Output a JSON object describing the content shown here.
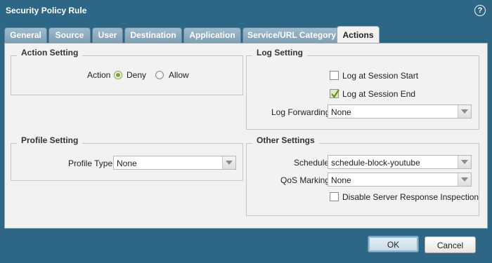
{
  "dialog": {
    "title": "Security Policy Rule"
  },
  "tabs": [
    {
      "label": "General"
    },
    {
      "label": "Source"
    },
    {
      "label": "User"
    },
    {
      "label": "Destination"
    },
    {
      "label": "Application"
    },
    {
      "label": "Service/URL Category"
    },
    {
      "label": "Actions",
      "active": true
    }
  ],
  "action_setting": {
    "legend": "Action Setting",
    "action_label": "Action",
    "options": [
      {
        "label": "Deny",
        "selected": true
      },
      {
        "label": "Allow",
        "selected": false
      }
    ]
  },
  "log_setting": {
    "legend": "Log Setting",
    "log_start_label": "Log at Session Start",
    "log_start_checked": false,
    "log_end_label": "Log at Session End",
    "log_end_checked": true,
    "forwarding_label": "Log Forwarding",
    "forwarding_value": "None"
  },
  "profile_setting": {
    "legend": "Profile Setting",
    "profile_type_label": "Profile Type",
    "profile_type_value": "None"
  },
  "other_settings": {
    "legend": "Other Settings",
    "schedule_label": "Schedule",
    "schedule_value": "schedule-block-youtube",
    "qos_label": "QoS Marking",
    "qos_value": "None",
    "disable_inspection_label": "Disable Server Response Inspection",
    "disable_inspection_checked": false
  },
  "buttons": {
    "ok": "OK",
    "cancel": "Cancel"
  },
  "colors": {
    "frame": "#2e6785",
    "panel": "#f2f2f2",
    "tab": "#8fadbf",
    "radio_selected": "#7fa820"
  },
  "icons": {
    "help": "help-icon"
  }
}
